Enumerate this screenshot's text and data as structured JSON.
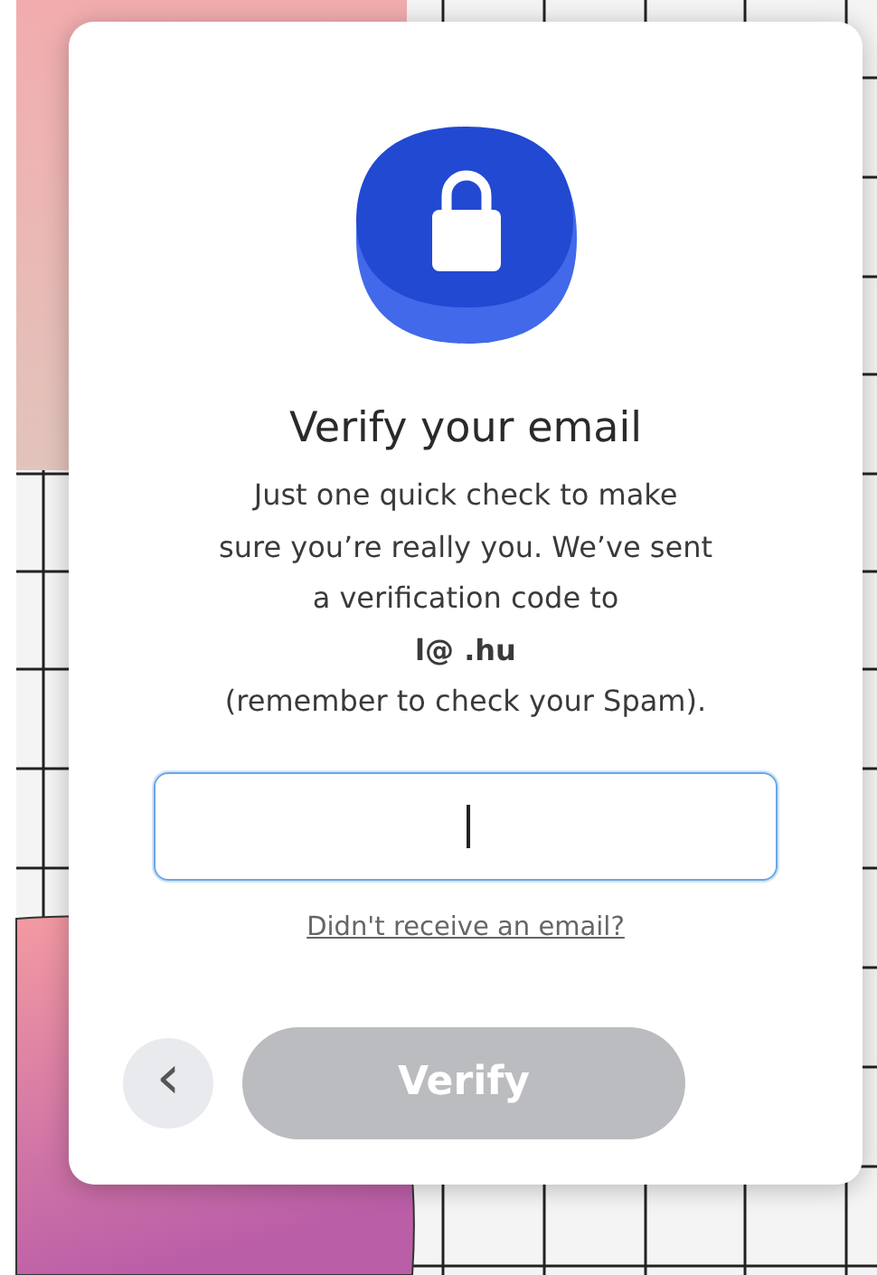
{
  "dialog": {
    "title": "Verify your email",
    "message_lines": [
      "Just one quick check to make",
      "sure you’re really you. We’ve sent",
      "a verification code to",
      "**l@  .hu**",
      "(remember to check your Spam)."
    ],
    "code_field": {
      "focused": true
    },
    "resend_link": "Didn't receive an email?",
    "back_button": {
      "label": "‹"
    },
    "verify_button": {
      "label": "Verify",
      "disabled": true
    }
  }
}
